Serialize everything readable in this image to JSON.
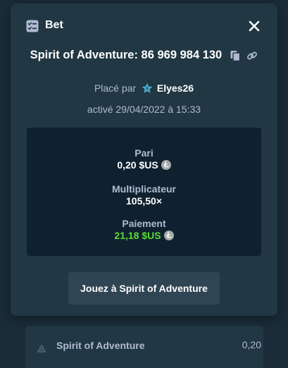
{
  "modal": {
    "title": "Bet",
    "game_line": "Spirit of Adventure: 86 969 984 130",
    "placed_by_prefix": "Placé par",
    "username": "Elyes26",
    "activated": "activé 29/04/2022 à 15:33",
    "stats": {
      "bet_label": "Pari",
      "bet_value": "0,20 $US",
      "multiplier_label": "Multiplicateur",
      "multiplier_value": "105,50×",
      "payout_label": "Paiement",
      "payout_value": "21,18 $US"
    },
    "play_button": "Jouez à Spirit of Adventure"
  },
  "background_row": {
    "game": "Spirit of Adventure",
    "amount": "0,20"
  },
  "icons": {
    "header": "bet-list-icon",
    "close": "close-icon",
    "copy": "copy-icon",
    "link": "link-icon",
    "rank": "star-icon",
    "currency": "litecoin-icon",
    "game": "slots-icon"
  },
  "colors": {
    "background": "#1a2c38",
    "modal": "#213743",
    "panel": "#0f212e",
    "button": "#2f4553",
    "muted_text": "#b1bad3",
    "payout_green": "#5ed73a",
    "rank_star": "#4ab8d8",
    "coin": "#a6a9aa"
  }
}
